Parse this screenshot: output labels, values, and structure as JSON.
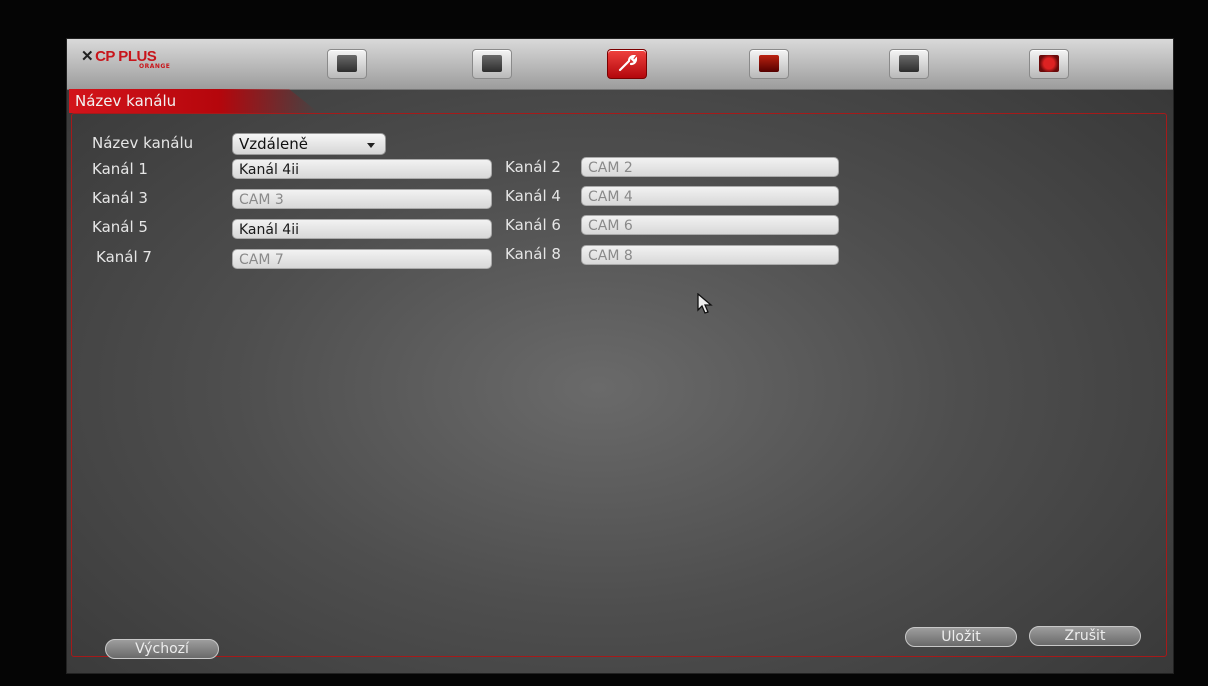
{
  "brand": {
    "name": "CP PLUS",
    "sub": "ORANGE"
  },
  "toolbar": {
    "items": [
      {
        "icon": "camera-icon"
      },
      {
        "icon": "record-icon"
      },
      {
        "icon": "wrench-icon",
        "active": true
      },
      {
        "icon": "list-icon"
      },
      {
        "icon": "backup-icon"
      },
      {
        "icon": "power-icon"
      }
    ]
  },
  "page": {
    "title": "Název kanálu"
  },
  "channel_name": {
    "label": "Název kanálu",
    "selected": "Vzdáleně"
  },
  "channels": [
    {
      "label": "Kanál 1",
      "value": "Kanál 4ii"
    },
    {
      "label": "Kanál 2",
      "value": "CAM 2"
    },
    {
      "label": "Kanál 3",
      "value": "CAM 3"
    },
    {
      "label": "Kanál 4",
      "value": "CAM 4"
    },
    {
      "label": "Kanál 5",
      "value": "Kanál 4ii"
    },
    {
      "label": "Kanál 6",
      "value": "CAM 6"
    },
    {
      "label": "Kanál 7",
      "value": "CAM 7"
    },
    {
      "label": "Kanál 8",
      "value": "CAM 8"
    }
  ],
  "buttons": {
    "default": "Výchozí",
    "save": "Uložit",
    "cancel": "Zrušit"
  },
  "colors": {
    "accent": "#c8151b",
    "frame": "#a51a1a"
  }
}
